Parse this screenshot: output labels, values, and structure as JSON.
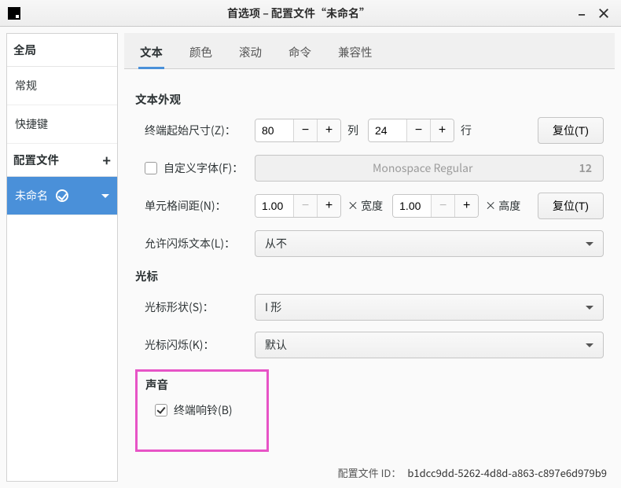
{
  "titlebar": {
    "title": "首选项 – 配置文件“未命名”"
  },
  "sidebar": {
    "global_header": "全局",
    "general": "常规",
    "shortcuts": "快捷键",
    "profiles_header": "配置文件",
    "selected_profile": "未命名"
  },
  "tabs": {
    "text": "文本",
    "color": "颜色",
    "scroll": "滚动",
    "command": "命令",
    "compat": "兼容性"
  },
  "section": {
    "appearance": "文本外观",
    "cursor": "光标",
    "sound": "声音"
  },
  "rows": {
    "init_size_label": "终端起始尺寸(Z)：",
    "columns": "80",
    "columns_unit": "列",
    "rows": "24",
    "rows_unit": "行",
    "reset": "复位(T)",
    "custom_font_label": "自定义字体(F)：",
    "font_name": "Monospace Regular",
    "font_size": "12",
    "cell_spacing_label": "单元格间距(N)：",
    "cell_w": "1.00",
    "cell_w_unit": "× 宽度",
    "cell_h": "1.00",
    "cell_h_unit": "× 高度",
    "blink_text_label": "允许闪烁文本(L)：",
    "blink_text_value": "从不",
    "cursor_shape_label": "光标形状(S)：",
    "cursor_shape_value": "I 形",
    "cursor_blink_label": "光标闪烁(K)：",
    "cursor_blink_value": "默认",
    "bell_label": "终端响铃(B)"
  },
  "footer": {
    "label": "配置文件 ID：",
    "value": "b1dcc9dd-5262-4d8d-a863-c897e6d979b9"
  }
}
